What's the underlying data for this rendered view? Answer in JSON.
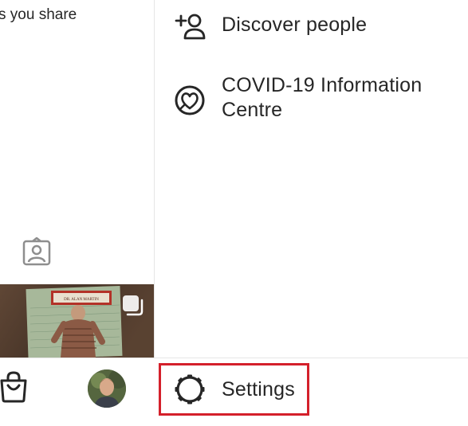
{
  "left_panel": {
    "share_text": "s you share"
  },
  "menu": {
    "discover_label": "Discover people",
    "covid_label_line1": "COVID-19 Information",
    "covid_label_line2": "Centre",
    "settings_label": "Settings"
  },
  "photo": {
    "sign_text": "DR. ALAN MARTIN"
  },
  "colors": {
    "highlight": "#d4202b",
    "text": "#262626",
    "divider": "#e6e6e6"
  }
}
